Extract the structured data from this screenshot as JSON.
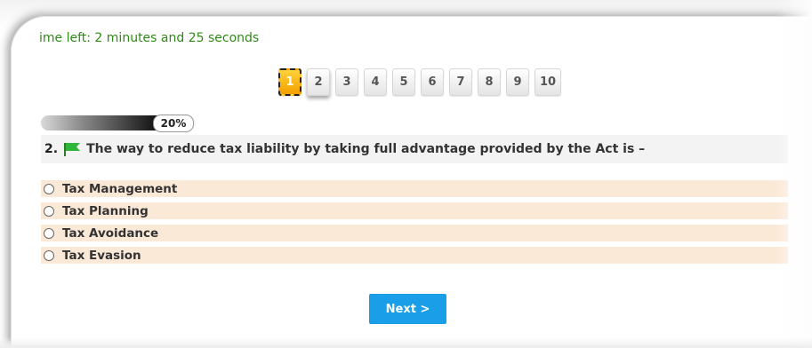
{
  "timer": {
    "text": "ime left: 2 minutes and 25 seconds"
  },
  "pager": {
    "pages": [
      {
        "label": "1",
        "state": "active"
      },
      {
        "label": "2",
        "state": "visited"
      },
      {
        "label": "3",
        "state": "default"
      },
      {
        "label": "4",
        "state": "default"
      },
      {
        "label": "5",
        "state": "default"
      },
      {
        "label": "6",
        "state": "default"
      },
      {
        "label": "7",
        "state": "default"
      },
      {
        "label": "8",
        "state": "default"
      },
      {
        "label": "9",
        "state": "default"
      },
      {
        "label": "10",
        "state": "default"
      }
    ]
  },
  "progress": {
    "label": "20%",
    "fraction": 0.2
  },
  "question": {
    "number": "2.",
    "flag_icon": "green-flag-icon",
    "text": "The way to reduce tax liability by taking full advantage provided by the Act is –"
  },
  "options": [
    {
      "label": "Tax Management"
    },
    {
      "label": "Tax Planning"
    },
    {
      "label": "Tax Avoidance"
    },
    {
      "label": "Tax Evasion"
    }
  ],
  "next_button": {
    "label": "Next >"
  },
  "colors": {
    "timer_text": "#2e8b16",
    "option_bg": "#fbe9d8",
    "button_bg": "#1a9ee8",
    "active_page": "#f3a000",
    "flag": "#2fb53a"
  }
}
